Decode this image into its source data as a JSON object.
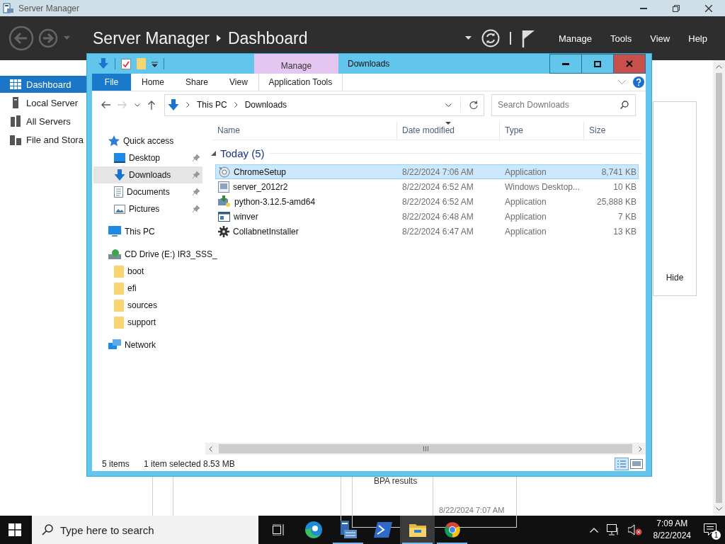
{
  "server_manager": {
    "window_title": "Server Manager",
    "breadcrumb": [
      "Server Manager",
      "Dashboard"
    ],
    "menu": [
      "Manage",
      "Tools",
      "View",
      "Help"
    ],
    "nav": [
      {
        "label": "Dashboard",
        "kind": "dashboard",
        "selected": true
      },
      {
        "label": "Local Server",
        "kind": "server",
        "selected": false
      },
      {
        "label": "All Servers",
        "kind": "servers",
        "selected": false
      },
      {
        "label": "File and Stora",
        "kind": "storage",
        "selected": false
      }
    ],
    "hide_button": "Hide",
    "tile": {
      "title": "BPA results",
      "time": "8/22/2024 7:07 AM"
    }
  },
  "explorer": {
    "title": "Downloads",
    "context_tab": "Manage",
    "ribbon_tabs": [
      {
        "label": "File",
        "kind": "file"
      },
      {
        "label": "Home",
        "kind": "tab"
      },
      {
        "label": "Share",
        "kind": "tab"
      },
      {
        "label": "View",
        "kind": "tab"
      },
      {
        "label": "Application Tools",
        "kind": "context"
      }
    ],
    "path": [
      "This PC",
      "Downloads"
    ],
    "search": {
      "placeholder": "Search Downloads"
    },
    "nav_pane": [
      {
        "label": "Quick access",
        "kind": "star",
        "selected": false,
        "children": [
          {
            "label": "Desktop",
            "kind": "desktop",
            "selected": false,
            "pinned": true
          },
          {
            "label": "Downloads",
            "kind": "download",
            "selected": true,
            "pinned": true
          },
          {
            "label": "Documents",
            "kind": "document",
            "selected": false,
            "pinned": true
          },
          {
            "label": "Pictures",
            "kind": "picture",
            "selected": false,
            "pinned": true
          }
        ]
      },
      {
        "label": "This PC",
        "kind": "pc",
        "selected": false
      },
      {
        "label": "CD Drive (E:) IR3_SSS_",
        "kind": "cd",
        "selected": false,
        "children": [
          {
            "label": "boot",
            "kind": "folder",
            "selected": false,
            "pinned": false
          },
          {
            "label": "efi",
            "kind": "folder",
            "selected": false,
            "pinned": false
          },
          {
            "label": "sources",
            "kind": "folder",
            "selected": false,
            "pinned": false
          },
          {
            "label": "support",
            "kind": "folder",
            "selected": false,
            "pinned": false
          }
        ]
      },
      {
        "label": "Network",
        "kind": "network",
        "selected": false
      }
    ],
    "columns": [
      {
        "label": "Name",
        "sorted": false
      },
      {
        "label": "Date modified",
        "sorted": true
      },
      {
        "label": "Type",
        "sorted": false
      },
      {
        "label": "Size",
        "sorted": false
      }
    ],
    "groups": [
      {
        "label": "Today (5)",
        "expanded": true,
        "files": [
          {
            "name": "ChromeSetup",
            "date": "8/22/2024 7:06 AM",
            "type": "Application",
            "size": "8,741 KB",
            "kind": "chrome",
            "selected": true
          },
          {
            "name": "server_2012r2",
            "date": "8/22/2024 6:52 AM",
            "type": "Windows Desktop...",
            "size": "10 KB",
            "kind": "rdp",
            "selected": false
          },
          {
            "name": "python-3.12.5-amd64",
            "date": "8/22/2024 6:52 AM",
            "type": "Application",
            "size": "25,888 KB",
            "kind": "python",
            "selected": false
          },
          {
            "name": "winver",
            "date": "8/22/2024 6:48 AM",
            "type": "Application",
            "size": "7 KB",
            "kind": "winver",
            "selected": false
          },
          {
            "name": "CollabnetInstaller",
            "date": "8/22/2024 6:47 AM",
            "type": "Application",
            "size": "13 KB",
            "kind": "installer",
            "selected": false
          }
        ]
      }
    ],
    "status": {
      "count": "5 items",
      "selection": "1 item selected",
      "size": "8.53 MB"
    }
  },
  "taskbar": {
    "search": {
      "placeholder": "Type here to search"
    },
    "apps": [
      {
        "kind": "taskview",
        "running": false,
        "active": false
      },
      {
        "kind": "edge",
        "running": false,
        "active": false
      },
      {
        "kind": "servermanager",
        "running": true,
        "active": false
      },
      {
        "kind": "powershell",
        "running": false,
        "active": false
      },
      {
        "kind": "explorer",
        "running": true,
        "active": true
      },
      {
        "kind": "chrome",
        "running": true,
        "active": false
      }
    ],
    "clock": {
      "time": "7:09 AM",
      "date": "8/22/2024"
    },
    "notifications": "1"
  }
}
